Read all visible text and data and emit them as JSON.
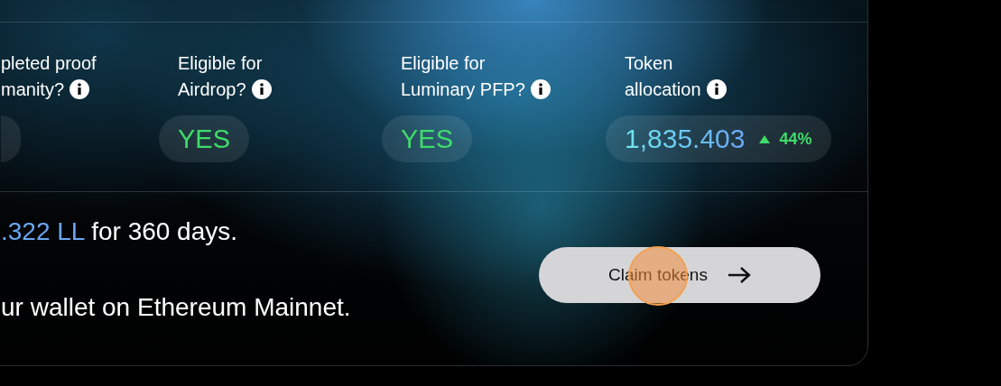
{
  "stats": [
    {
      "label": [
        "pleted proof",
        "manity?"
      ]
    },
    {
      "label": [
        "Eligible for",
        "Airdrop?"
      ],
      "value": "YES"
    },
    {
      "label": [
        "Eligible for",
        "Luminary PFP?"
      ],
      "value": "YES"
    },
    {
      "label": [
        "Token",
        "allocation"
      ],
      "value": "1,835.403",
      "change": "44%"
    }
  ],
  "summary": [
    {
      "amount": ".322 LL",
      "text": "for 360 days."
    },
    {
      "text": "ur wallet on Ethereum Mainnet."
    }
  ],
  "claim_button": {
    "label": "Claim tokens"
  }
}
